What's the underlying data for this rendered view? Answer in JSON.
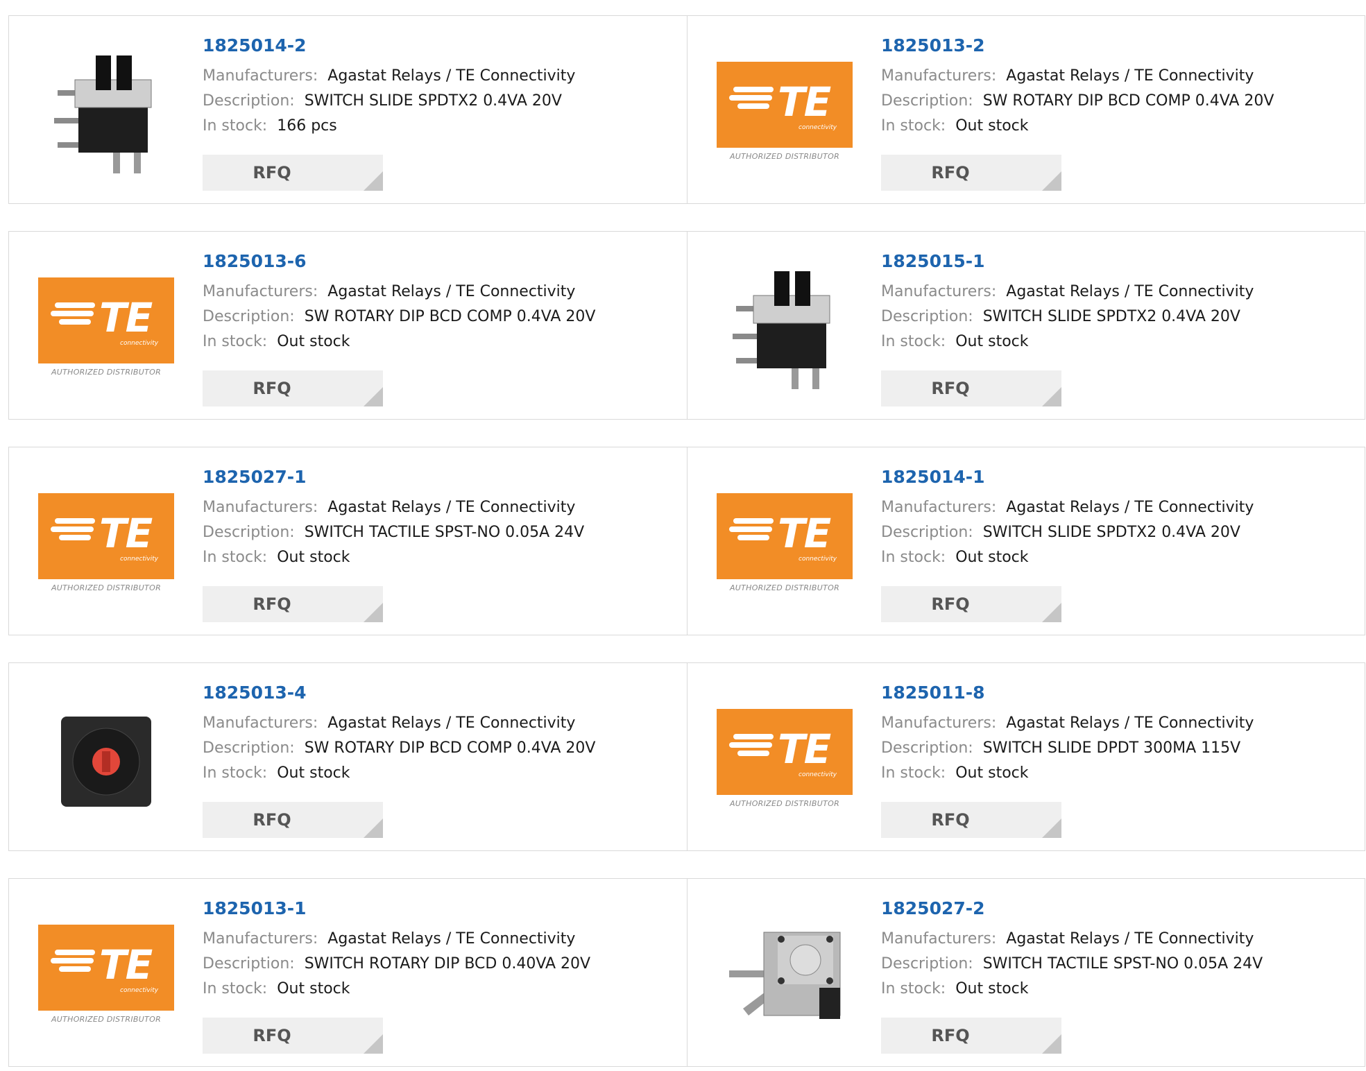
{
  "labels": {
    "manufacturers": "Manufacturers:",
    "description": "Description:",
    "in_stock": "In stock:"
  },
  "rfq_label": "RFQ",
  "logo": {
    "brand": "TE",
    "sub": "connectivity",
    "caption": "AUTHORIZED DISTRIBUTOR"
  },
  "products": [
    {
      "part": "1825014-2",
      "manufacturer": "Agastat Relays / TE Connectivity",
      "description": "SWITCH SLIDE SPDTX2 0.4VA 20V",
      "stock": "166 pcs",
      "image": "slide-switch-photo"
    },
    {
      "part": "1825013-2",
      "manufacturer": "Agastat Relays / TE Connectivity",
      "description": "SW ROTARY DIP BCD COMP 0.4VA 20V",
      "stock": "Out stock",
      "image": "te-logo"
    },
    {
      "part": "1825013-6",
      "manufacturer": "Agastat Relays / TE Connectivity",
      "description": "SW ROTARY DIP BCD COMP 0.4VA 20V",
      "stock": "Out stock",
      "image": "te-logo"
    },
    {
      "part": "1825015-1",
      "manufacturer": "Agastat Relays / TE Connectivity",
      "description": "SWITCH SLIDE SPDTX2 0.4VA 20V",
      "stock": "Out stock",
      "image": "slide-switch-photo"
    },
    {
      "part": "1825027-1",
      "manufacturer": "Agastat Relays / TE Connectivity",
      "description": "SWITCH TACTILE SPST-NO 0.05A 24V",
      "stock": "Out stock",
      "image": "te-logo"
    },
    {
      "part": "1825014-1",
      "manufacturer": "Agastat Relays / TE Connectivity",
      "description": "SWITCH SLIDE SPDTX2 0.4VA 20V",
      "stock": "Out stock",
      "image": "te-logo"
    },
    {
      "part": "1825013-4",
      "manufacturer": "Agastat Relays / TE Connectivity",
      "description": "SW ROTARY DIP BCD COMP 0.4VA 20V",
      "stock": "Out stock",
      "image": "rotary-dip-photo"
    },
    {
      "part": "1825011-8",
      "manufacturer": "Agastat Relays / TE Connectivity",
      "description": "SWITCH SLIDE DPDT 300MA 115V",
      "stock": "Out stock",
      "image": "te-logo"
    },
    {
      "part": "1825013-1",
      "manufacturer": "Agastat Relays / TE Connectivity",
      "description": "SWITCH ROTARY DIP BCD 0.40VA 20V",
      "stock": "Out stock",
      "image": "te-logo"
    },
    {
      "part": "1825027-2",
      "manufacturer": "Agastat Relays / TE Connectivity",
      "description": "SWITCH TACTILE SPST-NO 0.05A 24V",
      "stock": "Out stock",
      "image": "tactile-switch-photo"
    }
  ]
}
